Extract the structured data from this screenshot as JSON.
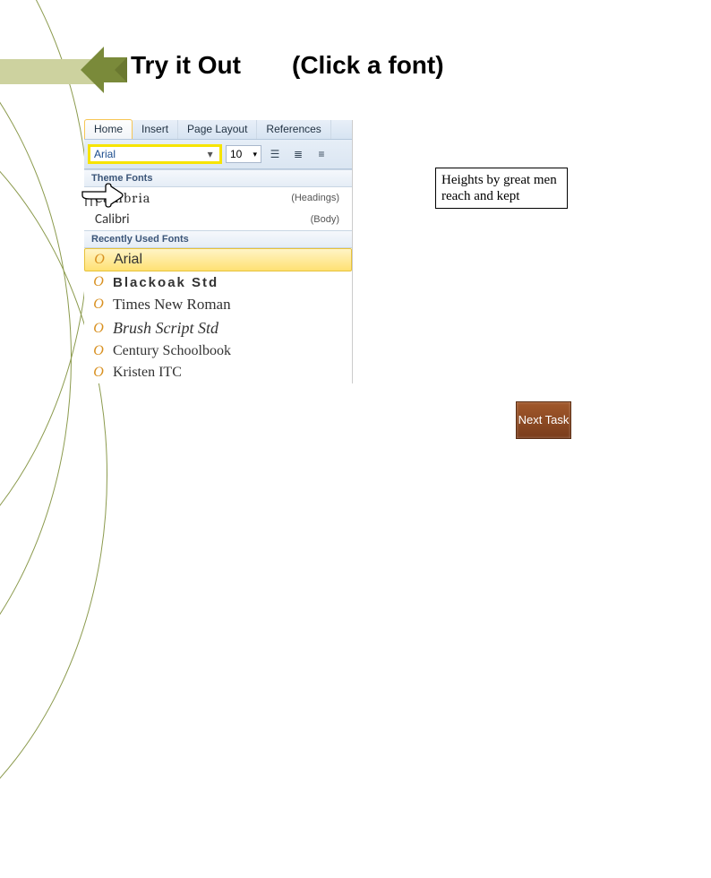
{
  "title": "Try it Out",
  "subtitle": "(Click a font)",
  "word": {
    "tabs": [
      "Home",
      "Insert",
      "Page Layout",
      "References"
    ],
    "active_tab": 0,
    "font_selected": "Arial",
    "size_selected": "10",
    "theme_header": "Theme Fonts",
    "recent_header": "Recently Used Fonts",
    "theme_fonts": [
      {
        "name": "Cambria",
        "meta": "(Headings)"
      },
      {
        "name": "Calibri",
        "meta": "(Body)"
      }
    ],
    "recent_fonts": [
      {
        "name": "Arial",
        "highlight": true
      },
      {
        "name": "Blackoak Std"
      },
      {
        "name": "Times New Roman"
      },
      {
        "name": "Brush Script Std"
      },
      {
        "name": "Century Schoolbook"
      },
      {
        "name": "Kristen ITC"
      }
    ]
  },
  "sample_text": "Heights by great men reach and kept",
  "next_button": "Next Task"
}
